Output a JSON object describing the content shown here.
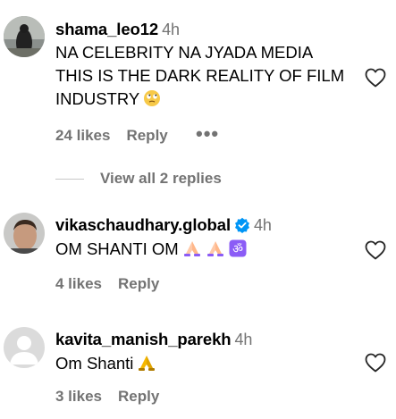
{
  "comments": [
    {
      "username": "shama_leo12",
      "time": "4h",
      "lines": [
        "NA CELEBRITY NA JYADA MEDIA",
        "THIS IS THE DARK REALITY OF FILM",
        "INDUSTRY"
      ],
      "emoji": "face-with-rolling-eyes",
      "likes": "24 likes",
      "reply": "Reply",
      "more": "•••",
      "view_replies": "View all 2 replies"
    },
    {
      "username": "vikaschaudhary.global",
      "time": "4h",
      "verified": true,
      "text": "OM SHANTI OM",
      "emojis": [
        "folded-hands",
        "folded-hands",
        "om-symbol"
      ],
      "likes": "4 likes",
      "reply": "Reply"
    },
    {
      "username": "kavita_manish_parekh",
      "time": "4h",
      "text": "Om Shanti",
      "emojis": [
        "folded-hands"
      ],
      "likes": "3 likes",
      "reply": "Reply"
    }
  ],
  "colors": {
    "secondary_text": "#737373",
    "verified_blue": "#0095f6",
    "emoji_purple": "#8b5cf6"
  }
}
